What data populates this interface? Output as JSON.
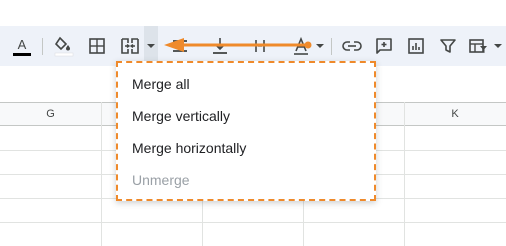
{
  "toolbar": {
    "items": [
      {
        "name": "text-color",
        "icon": "text-color-icon",
        "glyph": "A"
      },
      {
        "name": "fill-color",
        "icon": "fill-color-icon"
      },
      {
        "name": "borders",
        "icon": "borders-icon"
      },
      {
        "name": "merge-cells",
        "icon": "merge-cells-icon"
      },
      {
        "name": "horizontal-align",
        "icon": "horizontal-align-icon"
      },
      {
        "name": "vertical-align",
        "icon": "vertical-align-icon"
      },
      {
        "name": "text-wrapping",
        "icon": "text-wrapping-icon"
      },
      {
        "name": "text-rotation",
        "icon": "text-rotation-icon"
      },
      {
        "name": "insert-link",
        "icon": "link-icon"
      },
      {
        "name": "insert-comment",
        "icon": "add-comment-icon"
      },
      {
        "name": "insert-chart",
        "icon": "chart-icon"
      },
      {
        "name": "create-filter",
        "icon": "filter-icon"
      },
      {
        "name": "filter-views",
        "icon": "filter-views-icon"
      }
    ],
    "text_color_underline": "#000000",
    "fill_color_underline": "#ffffff"
  },
  "grid": {
    "columns": [
      "G",
      "",
      "",
      "",
      "K"
    ]
  },
  "merge_menu": {
    "items": [
      {
        "label": "Merge all",
        "enabled": true
      },
      {
        "label": "Merge vertically",
        "enabled": true
      },
      {
        "label": "Merge horizontally",
        "enabled": true
      },
      {
        "label": "Unmerge",
        "enabled": false
      }
    ]
  },
  "annotation": {
    "highlight_color": "#ef8a2b",
    "points_to": "merge-cells"
  }
}
